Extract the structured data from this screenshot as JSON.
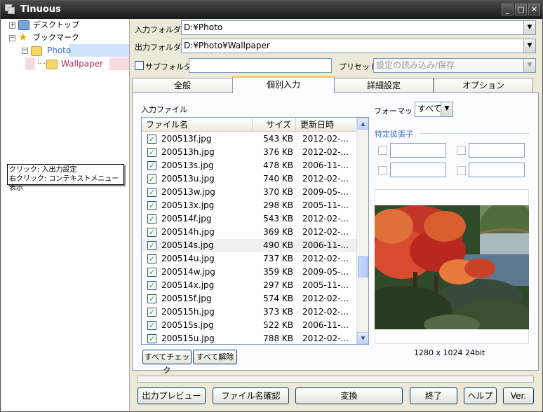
{
  "window": {
    "title": "Tinuous",
    "minimize": "_",
    "maximize": "□",
    "close": "✕"
  },
  "tree": {
    "items": [
      {
        "label": "デスクトップ",
        "expander": "+"
      },
      {
        "label": "ブックマーク",
        "expander": "−"
      },
      {
        "label": "Photo",
        "expander": "−"
      },
      {
        "label": "Wallpaper"
      }
    ],
    "tooltip": {
      "line1": "クリック: 入出力設定",
      "line2": "右クリック: コンテキストメニュー表示"
    }
  },
  "io": {
    "input_label": "入力フォルダ",
    "input_value": "D:¥Photo",
    "output_label": "出力フォルダ",
    "output_value": "D:¥Photo¥Wallpaper",
    "subfolder_label": "サブフォルダ",
    "subfolder_value": "",
    "preset_label": "プリセット",
    "preset_placeholder": "設定の読み込み/保存"
  },
  "tabs": [
    "全般",
    "個別入力",
    "詳細設定",
    "オプション"
  ],
  "files": {
    "section_label": "入力ファイル",
    "columns": [
      "ファイル名",
      "サイズ",
      "更新日時"
    ],
    "rows": [
      {
        "name": "200513f.jpg",
        "size": "543 KB",
        "date": "2012-02-..."
      },
      {
        "name": "200513h.jpg",
        "size": "376 KB",
        "date": "2012-02-..."
      },
      {
        "name": "200513s.jpg",
        "size": "478 KB",
        "date": "2006-11-..."
      },
      {
        "name": "200513u.jpg",
        "size": "740 KB",
        "date": "2012-02-..."
      },
      {
        "name": "200513w.jpg",
        "size": "370 KB",
        "date": "2009-05-..."
      },
      {
        "name": "200513x.jpg",
        "size": "298 KB",
        "date": "2005-11-..."
      },
      {
        "name": "200514f.jpg",
        "size": "543 KB",
        "date": "2012-02-..."
      },
      {
        "name": "200514h.jpg",
        "size": "369 KB",
        "date": "2012-02-..."
      },
      {
        "name": "200514s.jpg",
        "size": "490 KB",
        "date": "2006-11-..."
      },
      {
        "name": "200514u.jpg",
        "size": "737 KB",
        "date": "2012-02-..."
      },
      {
        "name": "200514w.jpg",
        "size": "359 KB",
        "date": "2009-05-..."
      },
      {
        "name": "200514x.jpg",
        "size": "297 KB",
        "date": "2005-11-..."
      },
      {
        "name": "200515f.jpg",
        "size": "574 KB",
        "date": "2012-02-..."
      },
      {
        "name": "200515h.jpg",
        "size": "373 KB",
        "date": "2012-02-..."
      },
      {
        "name": "200515s.jpg",
        "size": "522 KB",
        "date": "2006-11-..."
      },
      {
        "name": "200515u.jpg",
        "size": "788 KB",
        "date": "2012-02-..."
      }
    ],
    "check_all": "すべてチェック",
    "uncheck_all": "すべて解除"
  },
  "format": {
    "label": "フォーマット:",
    "value": "すべて"
  },
  "ext": {
    "label": "特定拡張子"
  },
  "preview": {
    "info": "1280 x 1024  24bit"
  },
  "buttons": {
    "preview": "出力プレビュー",
    "confirm": "ファイル名確認",
    "convert": "変換",
    "exit": "終了",
    "help": "ヘルプ",
    "version": "Ver."
  }
}
